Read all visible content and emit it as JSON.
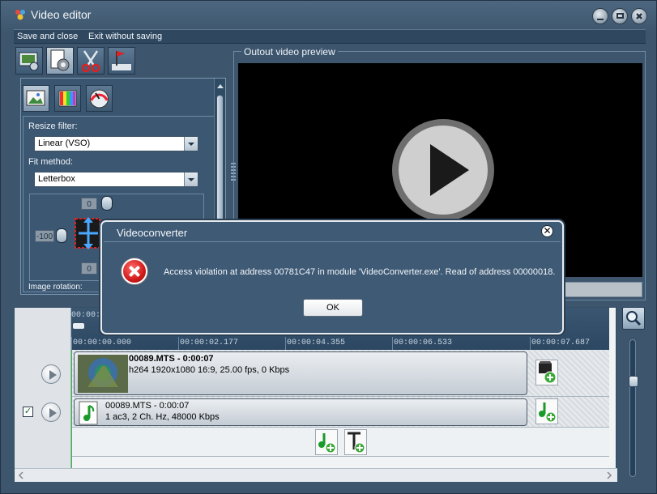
{
  "window": {
    "title": "Video editor",
    "app_icon": "video-editor-icon"
  },
  "menu": {
    "save_close": "Save and close",
    "exit_no_save": "Exit without saving"
  },
  "toolbar_tabs": [
    {
      "icon": "properties-icon"
    },
    {
      "icon": "settings-icon"
    },
    {
      "icon": "scissors-icon"
    },
    {
      "icon": "marker-icon"
    }
  ],
  "sub_tabs": [
    {
      "icon": "image-icon"
    },
    {
      "icon": "color-bars-icon"
    },
    {
      "icon": "gauge-icon"
    }
  ],
  "settings": {
    "resize_filter_label": "Resize filter:",
    "resize_filter_value": "Linear (VSO)",
    "fit_method_label": "Fit method:",
    "fit_method_value": "Letterbox",
    "top_offset": "0",
    "left_offset": "-100",
    "bottom_offset": "0",
    "image_rotation_label": "Image rotation:"
  },
  "preview": {
    "title": "Outout video preview"
  },
  "timeline": {
    "ruler_start": "00:00:",
    "ticks": [
      "00:00:00.000",
      "00:00:02.177",
      "00:00:04.355",
      "00:00:06.533",
      "00:00:07.687"
    ],
    "video_clip": {
      "name": "00089.MTS - 0:00:07",
      "info": "h264 1920x1080 16:9, 25.00 fps, 0 Kbps"
    },
    "audio_clip": {
      "name": "00089.MTS - 0:00:07",
      "info": "1 ac3, 2 Ch. Hz, 48000 Kbps"
    },
    "audio_checked": "✓"
  },
  "dialog": {
    "title": "Videoconverter",
    "message": "Access violation at address 00781C47 in module 'VideoConverter.exe'. Read of address 00000018.",
    "ok_label": "OK",
    "close_glyph": "✕"
  }
}
